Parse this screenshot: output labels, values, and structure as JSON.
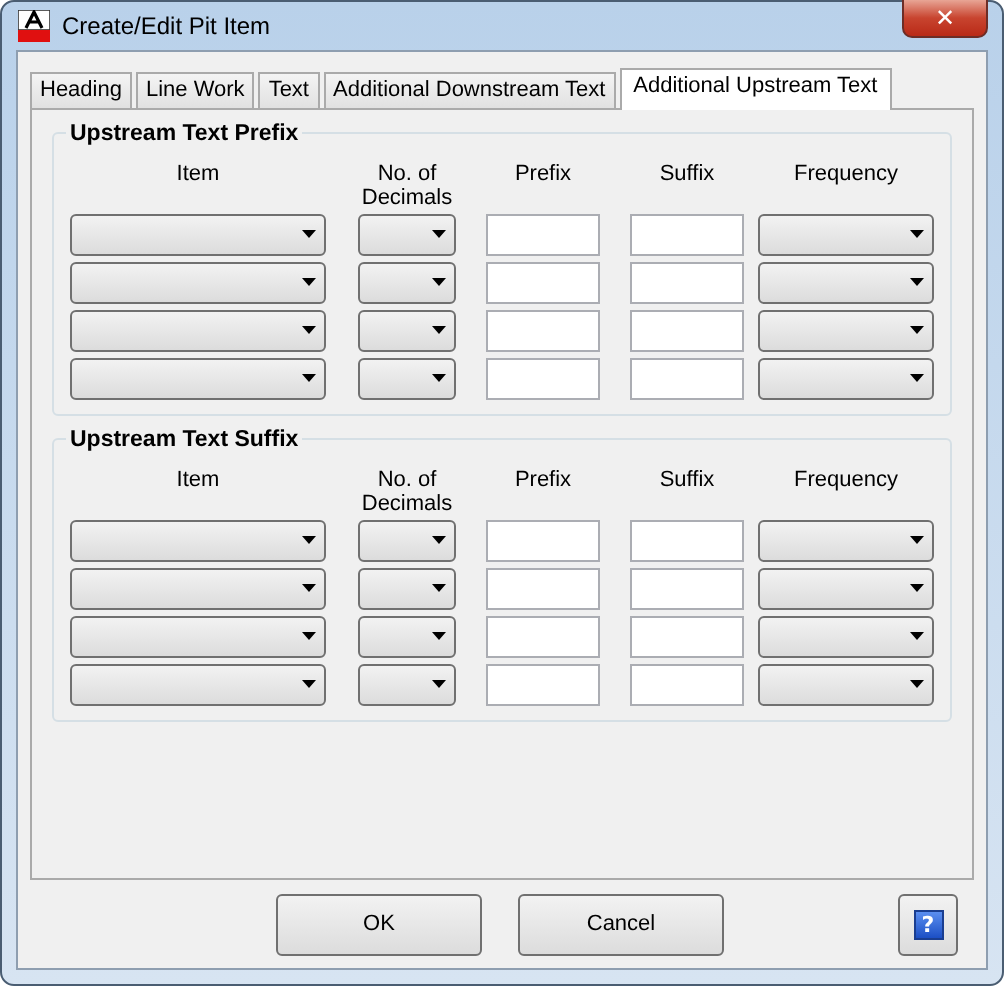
{
  "window": {
    "title": "Create/Edit Pit Item",
    "close": "✕"
  },
  "tabs": [
    {
      "label": "Heading",
      "selected": false
    },
    {
      "label": "Line Work",
      "selected": false
    },
    {
      "label": "Text",
      "selected": false
    },
    {
      "label": "Additional Downstream Text",
      "selected": false
    },
    {
      "label": "Additional Upstream Text",
      "selected": true
    }
  ],
  "groups": [
    {
      "title": "Upstream Text Prefix",
      "columns": [
        "Item",
        "No. of Decimals",
        "Prefix",
        "Suffix",
        "Frequency"
      ],
      "rows": [
        {
          "cells": [
            {
              "kind": "dropdown"
            },
            {
              "kind": "dropdown"
            },
            {
              "kind": "field"
            },
            {
              "kind": "field"
            },
            {
              "kind": "dropdown"
            }
          ]
        },
        {
          "cells": [
            {
              "kind": "dropdown"
            },
            {
              "kind": "dropdown"
            },
            {
              "kind": "field"
            },
            {
              "kind": "field"
            },
            {
              "kind": "dropdown"
            }
          ]
        },
        {
          "cells": [
            {
              "kind": "dropdown"
            },
            {
              "kind": "dropdown"
            },
            {
              "kind": "field"
            },
            {
              "kind": "field"
            },
            {
              "kind": "dropdown"
            }
          ]
        },
        {
          "cells": [
            {
              "kind": "dropdown"
            },
            {
              "kind": "dropdown"
            },
            {
              "kind": "field"
            },
            {
              "kind": "field"
            },
            {
              "kind": "dropdown"
            }
          ]
        }
      ]
    },
    {
      "title": "Upstream Text Suffix",
      "columns": [
        "Item",
        "No. of Decimals",
        "Prefix",
        "Suffix",
        "Frequency"
      ],
      "rows": [
        {
          "cells": [
            {
              "kind": "dropdown"
            },
            {
              "kind": "dropdown"
            },
            {
              "kind": "field"
            },
            {
              "kind": "field"
            },
            {
              "kind": "dropdown"
            }
          ]
        },
        {
          "cells": [
            {
              "kind": "dropdown"
            },
            {
              "kind": "dropdown"
            },
            {
              "kind": "field"
            },
            {
              "kind": "field"
            },
            {
              "kind": "dropdown"
            }
          ]
        },
        {
          "cells": [
            {
              "kind": "dropdown"
            },
            {
              "kind": "dropdown"
            },
            {
              "kind": "field"
            },
            {
              "kind": "field"
            },
            {
              "kind": "dropdown"
            }
          ]
        },
        {
          "cells": [
            {
              "kind": "dropdown"
            },
            {
              "kind": "dropdown"
            },
            {
              "kind": "field"
            },
            {
              "kind": "field"
            },
            {
              "kind": "dropdown"
            }
          ]
        }
      ]
    }
  ],
  "buttons": [
    {
      "label": "OK",
      "kind": "push"
    },
    {
      "label": "Cancel",
      "kind": "push"
    },
    {
      "label": "?",
      "kind": "help"
    }
  ]
}
